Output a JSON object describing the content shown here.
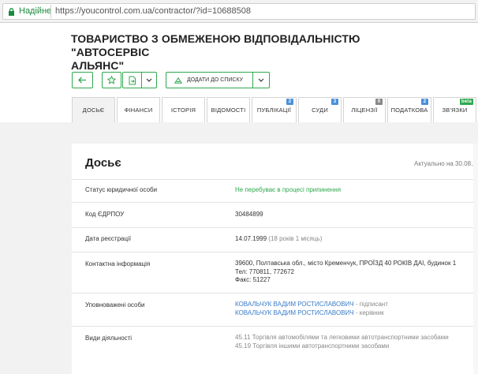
{
  "browser": {
    "secure_label": "Надійне",
    "url": "https://youcontrol.com.ua/contractor/?id=10688508"
  },
  "company": {
    "title_line1": "ТОВАРИСТВО З ОБМЕЖЕНОЮ ВІДПОВІДАЛЬНІСТЮ \"АВТОСЕРВІС",
    "title_line2": "АЛЬЯНС\""
  },
  "toolbar": {
    "add_to_list_label": "ДОДАТИ ДО СПИСКУ",
    "icons": [
      "back-arrow-icon",
      "star-icon",
      "export-icon",
      "chevron-down-icon",
      "list-icon",
      "chevron-down-icon"
    ]
  },
  "tabs": [
    {
      "label": "ДОСЬЄ",
      "badge": ""
    },
    {
      "label": "ФІНАНСИ",
      "badge": ""
    },
    {
      "label": "ІСТОРІЯ",
      "badge": ""
    },
    {
      "label": "ВІДОМОСТІ",
      "badge": ""
    },
    {
      "label": "ПУБЛІКАЦІЇ",
      "badge": "2"
    },
    {
      "label": "СУДИ",
      "badge": "3"
    },
    {
      "label": "ЛІЦЕНЗІЇ",
      "badge": "0"
    },
    {
      "label": "ПОДАТКОВА",
      "badge": "2"
    },
    {
      "label": "ЗВ'ЯЗКИ",
      "badge": "beta"
    }
  ],
  "dossier": {
    "title": "Досьє",
    "updated": "Актуально на 30.08.20",
    "status_label": "Статус юридичної особи",
    "status_value": "Не перебуває в процесі припинення",
    "code_label": "Код ЄДРПОУ",
    "code_value": "30484899",
    "date_label": "Дата реєстрації",
    "date_value": "14.07.1999",
    "date_age": "(18 років 1 місяць)",
    "contact_label": "Контактна інформація",
    "contact_address": "39600, Полтавська обл., місто Кременчук, ПРОЇЗД 40 РОКІВ ДАІ, будинок 1",
    "contact_phone_label": "Тел:",
    "contact_phone": "770811, 772672",
    "contact_fax_label": "Факс:",
    "contact_fax": "51227",
    "persons_label": "Уповноважені особи",
    "persons": [
      {
        "name": "КОВАЛЬЧУК ВАДИМ РОСТИСЛАВОВИЧ",
        "role": "- підписант"
      },
      {
        "name": "КОВАЛЬЧУК ВАДИМ РОСТИСЛАВОВИЧ",
        "role": "- керівник"
      }
    ],
    "activities_label": "Види діяльності",
    "activities": [
      {
        "code": "45.11",
        "text": "Торгівля автомобілями та легковими автотранспортними засобами"
      },
      {
        "code": "45.19",
        "text": "Торгівля іншими автотранспортними засобами"
      }
    ]
  },
  "colors": {
    "accent": "#2fa84f",
    "link": "#3a7cc7",
    "badge_blue": "#4a90d9",
    "badge_gray": "#888888"
  }
}
